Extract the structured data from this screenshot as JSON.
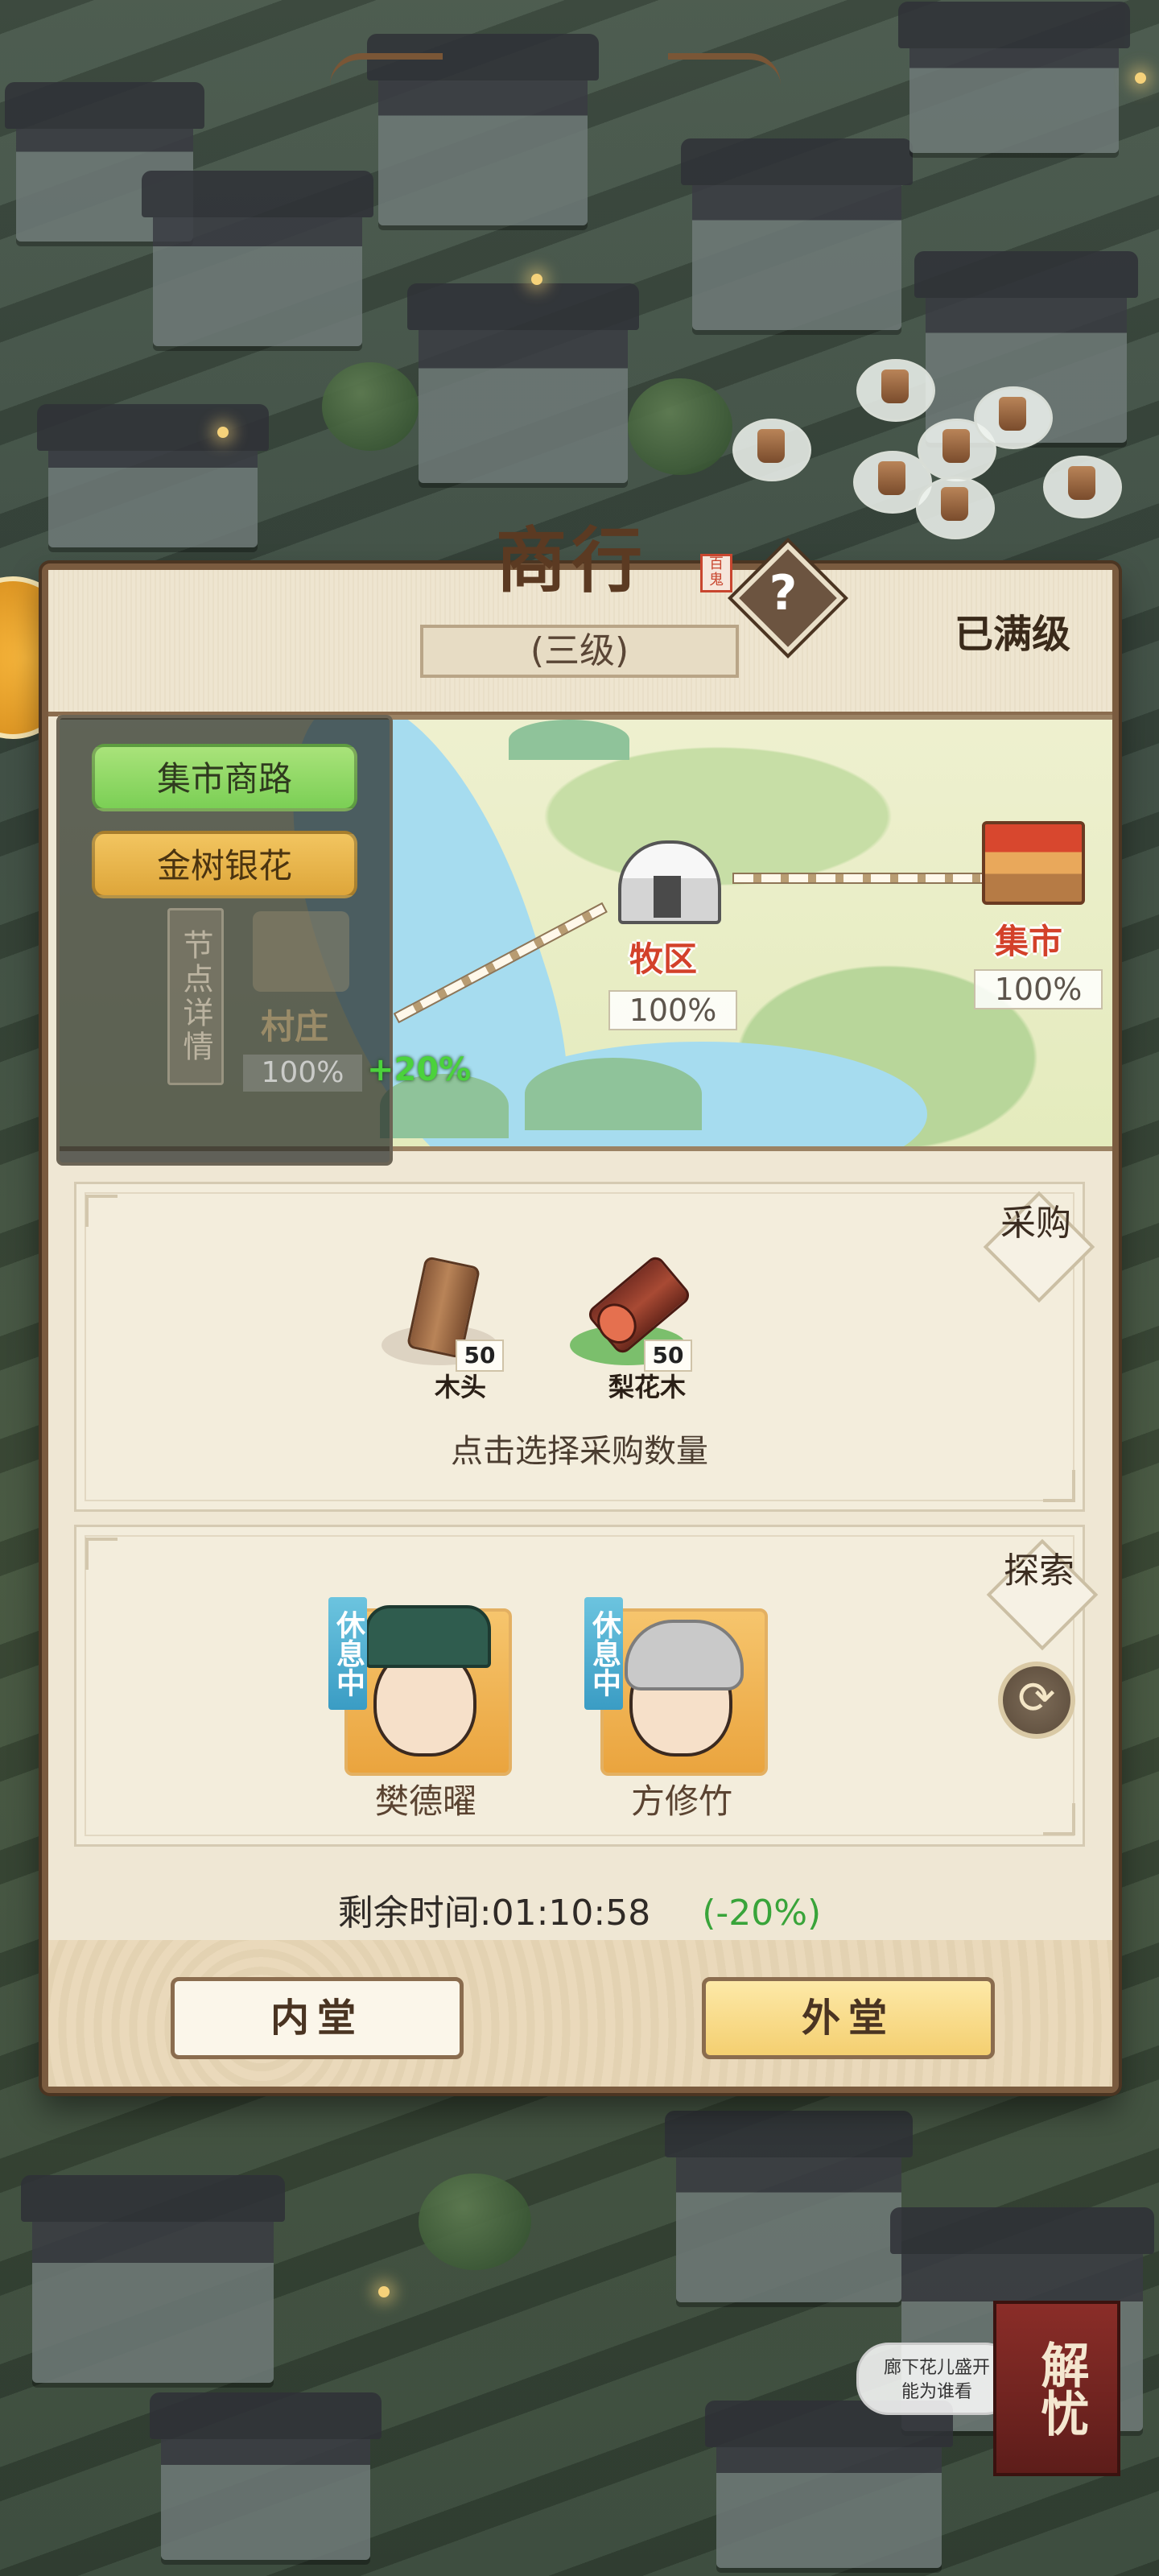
{
  "header": {
    "title": "商行",
    "seal": "百鬼",
    "help_icon": "question-icon",
    "level": "(三级)",
    "max_level": "已满级"
  },
  "routes": {
    "market_route": "集市商路",
    "gold_route": "金树银花",
    "node_detail": "节点详情"
  },
  "map_nodes": [
    {
      "name": "村庄",
      "percent": "100%"
    },
    {
      "name": "牧区",
      "percent": "100%"
    },
    {
      "name": "集市",
      "percent": "100%"
    }
  ],
  "map_bonus": "+20%",
  "buy": {
    "tag": "采购",
    "items": [
      {
        "name": "木头",
        "qty": "50"
      },
      {
        "name": "梨花木",
        "qty": "50"
      }
    ],
    "hint": "点击选择采购数量"
  },
  "explore": {
    "tag": "探索",
    "heroes": [
      {
        "name": "樊德曜",
        "status": "休息中"
      },
      {
        "name": "方修竹",
        "status": "休息中"
      }
    ],
    "refresh_icon": "refresh-icon"
  },
  "timer": {
    "label": "剩余时间:01:10:58",
    "modifier": "(-20%)"
  },
  "footer": {
    "inner_hall": "内堂",
    "outer_hall": "外堂"
  },
  "widgets": {
    "chat_line1": "廊下花儿盛开",
    "chat_line2": "能为谁看",
    "relieve": "解忧"
  }
}
